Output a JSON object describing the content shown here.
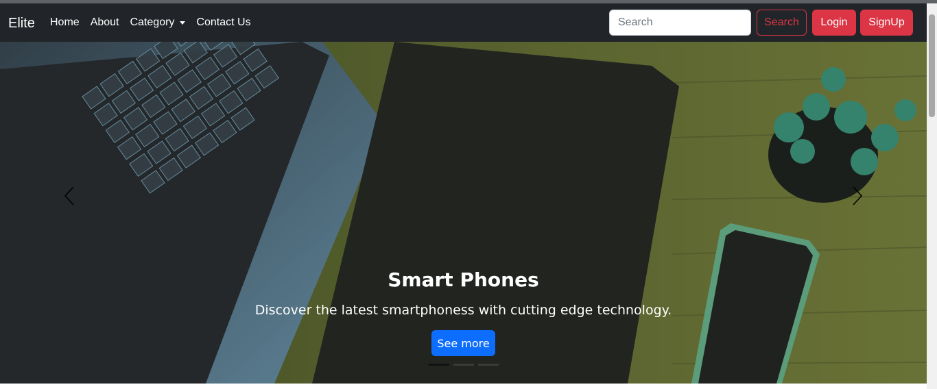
{
  "navbar": {
    "brand": "Elite",
    "links": [
      {
        "label": "Home"
      },
      {
        "label": "About"
      },
      {
        "label": "Category"
      },
      {
        "label": "Contact Us"
      }
    ],
    "search": {
      "placeholder": "Search",
      "button_label": "Search"
    },
    "login_label": "Login",
    "signup_label": "SignUp"
  },
  "carousel": {
    "active_slide": 1,
    "slide_count": 3,
    "caption": {
      "title": "Smart Phones",
      "text": "Discover the latest smartphoness with cutting edge technology.",
      "button_label": "See more"
    }
  },
  "colors": {
    "navbar_bg": "#212529",
    "danger": "#dc3545",
    "primary": "#0d6efd"
  },
  "icons": {
    "prev": "chevron-left-icon",
    "next": "chevron-right-icon",
    "caret": "caret-down-icon"
  }
}
